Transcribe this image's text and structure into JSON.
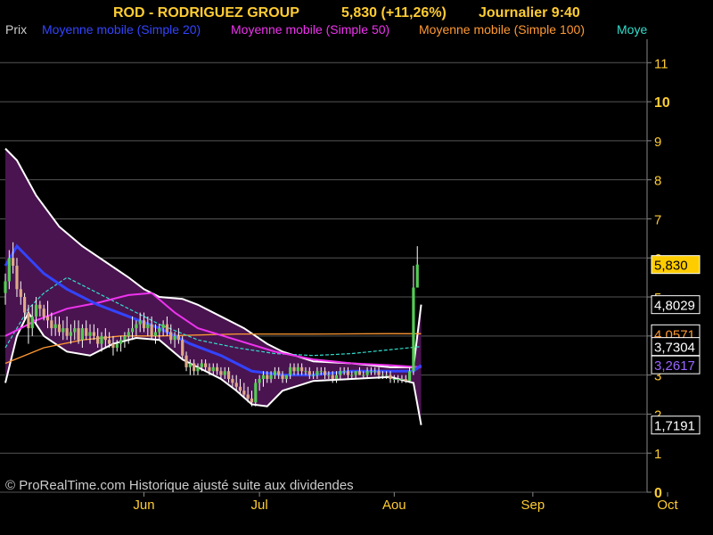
{
  "header": {
    "ticker": "ROD - RODRIGUEZ GROUP",
    "price_change": "5,830 (+11,26%)",
    "period_time": "Journalier  9:40"
  },
  "legend": {
    "items": [
      {
        "label": "Prix",
        "color": "#cccccc"
      },
      {
        "label": "Moyenne mobile (Simple 20)",
        "color": "#3344ff"
      },
      {
        "label": "Moyenne mobile (Simple 50)",
        "color": "#ee33ee"
      },
      {
        "label": "Moyenne mobile (Simple 100)",
        "color": "#ff9933"
      },
      {
        "label": "Moye",
        "color": "#33ddcc"
      }
    ]
  },
  "footer": {
    "copyright": "© ProRealTime.com Historique ajusté suite aux dividendes"
  },
  "colors": {
    "background": "#000000",
    "grid": "#555555",
    "axis_text": "#ffcc33",
    "band_fill": "#4a1450",
    "band_edge": "#ffffff",
    "candle_up": "#55cc55",
    "candle_down": "#ddaa88",
    "wick": "#ffffff"
  },
  "chart_data": {
    "type": "candlestick",
    "ylim": [
      0,
      11.6
    ],
    "y_ticks": [
      "0",
      "1",
      "2",
      "3",
      "4",
      "5",
      "6",
      "7",
      "8",
      "9",
      "10",
      "11"
    ],
    "x_ticks": [
      {
        "label": "Jun",
        "index": 36
      },
      {
        "label": "Jul",
        "index": 66
      },
      {
        "label": "Aou",
        "index": 101
      },
      {
        "label": "Sep",
        "index": 137
      },
      {
        "label": "Oct",
        "index": 172
      }
    ],
    "candles": [
      [
        5.1,
        5.6,
        4.8,
        5.4
      ],
      [
        5.4,
        6.2,
        5.2,
        6.0
      ],
      [
        6.0,
        6.4,
        5.6,
        5.8
      ],
      [
        5.8,
        6.0,
        5.0,
        5.2
      ],
      [
        5.2,
        5.4,
        4.8,
        5.0
      ],
      [
        5.0,
        5.1,
        4.4,
        4.6
      ],
      [
        4.6,
        4.8,
        3.8,
        4.2
      ],
      [
        4.2,
        4.8,
        4.0,
        4.5
      ],
      [
        4.5,
        5.0,
        4.3,
        4.8
      ],
      [
        4.8,
        4.9,
        4.5,
        4.7
      ],
      [
        4.7,
        4.8,
        4.4,
        4.5
      ],
      [
        4.5,
        4.9,
        4.2,
        4.4
      ],
      [
        4.4,
        4.6,
        4.0,
        4.2
      ],
      [
        4.2,
        4.5,
        4.0,
        4.3
      ],
      [
        4.3,
        4.5,
        4.0,
        4.1
      ],
      [
        4.1,
        4.4,
        3.9,
        4.2
      ],
      [
        4.2,
        4.5,
        3.9,
        4.0
      ],
      [
        4.0,
        4.3,
        3.8,
        4.1
      ],
      [
        4.1,
        4.4,
        3.9,
        4.2
      ],
      [
        4.2,
        4.4,
        3.8,
        3.9
      ],
      [
        3.9,
        4.3,
        3.7,
        4.2
      ],
      [
        4.2,
        4.4,
        3.9,
        4.0
      ],
      [
        4.0,
        4.3,
        3.8,
        4.1
      ],
      [
        4.1,
        4.3,
        3.9,
        4.0
      ],
      [
        4.0,
        4.2,
        3.7,
        3.8
      ],
      [
        3.8,
        4.1,
        3.6,
        4.0
      ],
      [
        4.0,
        4.2,
        3.7,
        3.9
      ],
      [
        3.9,
        4.1,
        3.7,
        3.8
      ],
      [
        3.8,
        4.0,
        3.5,
        3.7
      ],
      [
        3.7,
        3.9,
        3.6,
        3.8
      ],
      [
        3.8,
        4.0,
        3.6,
        3.9
      ],
      [
        3.9,
        4.1,
        3.7,
        4.0
      ],
      [
        4.0,
        4.2,
        3.8,
        4.1
      ],
      [
        4.1,
        4.5,
        3.9,
        4.2
      ],
      [
        4.2,
        4.4,
        4.0,
        4.3
      ],
      [
        4.3,
        4.6,
        4.1,
        4.4
      ],
      [
        4.4,
        4.6,
        4.1,
        4.2
      ],
      [
        4.2,
        4.5,
        4.0,
        4.3
      ],
      [
        4.3,
        4.5,
        3.9,
        4.0
      ],
      [
        4.0,
        4.3,
        3.8,
        4.1
      ],
      [
        4.1,
        4.3,
        3.9,
        4.2
      ],
      [
        4.2,
        4.4,
        4.0,
        4.3
      ],
      [
        4.3,
        4.5,
        4.0,
        4.1
      ],
      [
        4.1,
        4.3,
        3.8,
        3.9
      ],
      [
        3.9,
        4.1,
        3.7,
        4.0
      ],
      [
        4.0,
        4.2,
        3.8,
        3.9
      ],
      [
        3.9,
        4.0,
        3.4,
        3.5
      ],
      [
        3.5,
        3.6,
        3.1,
        3.2
      ],
      [
        3.2,
        3.4,
        3.0,
        3.3
      ],
      [
        3.3,
        3.4,
        3.0,
        3.1
      ],
      [
        3.1,
        3.3,
        3.0,
        3.2
      ],
      [
        3.2,
        3.4,
        3.1,
        3.3
      ],
      [
        3.3,
        3.4,
        3.1,
        3.2
      ],
      [
        3.2,
        3.3,
        3.0,
        3.1
      ],
      [
        3.1,
        3.3,
        3.0,
        3.2
      ],
      [
        3.2,
        3.3,
        3.0,
        3.1
      ],
      [
        3.1,
        3.2,
        2.9,
        3.0
      ],
      [
        3.0,
        3.2,
        2.9,
        3.1
      ],
      [
        3.1,
        3.2,
        2.8,
        2.9
      ],
      [
        2.9,
        3.0,
        2.7,
        2.8
      ],
      [
        2.8,
        3.0,
        2.6,
        2.7
      ],
      [
        2.7,
        2.9,
        2.5,
        2.6
      ],
      [
        2.6,
        2.8,
        2.4,
        2.5
      ],
      [
        2.5,
        2.7,
        2.3,
        2.4
      ],
      [
        2.4,
        2.6,
        2.2,
        2.3
      ],
      [
        2.3,
        2.9,
        2.2,
        2.8
      ],
      [
        2.8,
        3.0,
        2.6,
        2.9
      ],
      [
        2.9,
        3.1,
        2.7,
        3.0
      ],
      [
        3.0,
        3.1,
        2.8,
        2.9
      ],
      [
        2.9,
        3.1,
        2.8,
        3.0
      ],
      [
        3.0,
        3.2,
        2.9,
        3.1
      ],
      [
        3.1,
        3.2,
        2.9,
        3.0
      ],
      [
        3.0,
        3.1,
        2.8,
        2.9
      ],
      [
        2.9,
        3.0,
        2.8,
        3.0
      ],
      [
        3.0,
        3.3,
        2.9,
        3.2
      ],
      [
        3.2,
        3.3,
        3.0,
        3.1
      ],
      [
        3.1,
        3.3,
        3.0,
        3.2
      ],
      [
        3.2,
        3.3,
        3.0,
        3.1
      ],
      [
        3.1,
        3.2,
        3.0,
        3.1
      ],
      [
        3.1,
        3.2,
        2.9,
        3.0
      ],
      [
        3.0,
        3.1,
        2.9,
        3.0
      ],
      [
        3.0,
        3.2,
        2.9,
        3.1
      ],
      [
        3.1,
        3.2,
        3.0,
        3.1
      ],
      [
        3.1,
        3.2,
        2.9,
        3.0
      ],
      [
        3.0,
        3.1,
        2.9,
        3.0
      ],
      [
        3.0,
        3.1,
        2.8,
        2.9
      ],
      [
        2.9,
        3.1,
        2.8,
        3.0
      ],
      [
        3.0,
        3.2,
        2.9,
        3.1
      ],
      [
        3.1,
        3.2,
        3.0,
        3.1
      ],
      [
        3.1,
        3.2,
        2.9,
        3.0
      ],
      [
        3.0,
        3.1,
        2.9,
        3.0
      ],
      [
        3.0,
        3.1,
        2.9,
        3.1
      ],
      [
        3.1,
        3.2,
        3.0,
        3.0
      ],
      [
        3.0,
        3.1,
        2.9,
        3.0
      ],
      [
        3.0,
        3.2,
        2.9,
        3.1
      ],
      [
        3.1,
        3.2,
        3.0,
        3.1
      ],
      [
        3.1,
        3.2,
        3.0,
        3.1
      ],
      [
        3.1,
        3.2,
        2.9,
        3.0
      ],
      [
        3.0,
        3.1,
        2.9,
        3.0
      ],
      [
        3.0,
        3.1,
        2.9,
        3.0
      ],
      [
        3.0,
        3.1,
        2.8,
        2.9
      ],
      [
        2.9,
        3.0,
        2.8,
        2.9
      ],
      [
        2.9,
        3.0,
        2.8,
        2.9
      ],
      [
        2.9,
        3.0,
        2.8,
        2.9
      ],
      [
        2.9,
        3.0,
        2.8,
        2.85
      ],
      [
        2.85,
        3.2,
        2.8,
        3.1
      ],
      [
        3.1,
        5.8,
        3.0,
        5.24
      ],
      [
        5.24,
        6.3,
        5.6,
        5.83
      ]
    ],
    "sma20": [
      [
        0,
        5.8
      ],
      [
        3,
        6.3
      ],
      [
        6,
        6.0
      ],
      [
        10,
        5.6
      ],
      [
        16,
        5.2
      ],
      [
        24,
        4.8
      ],
      [
        32,
        4.5
      ],
      [
        40,
        4.2
      ],
      [
        48,
        3.8
      ],
      [
        56,
        3.5
      ],
      [
        64,
        3.1
      ],
      [
        72,
        3.0
      ],
      [
        80,
        3.0
      ],
      [
        90,
        3.1
      ],
      [
        100,
        3.1
      ],
      [
        106,
        3.1
      ],
      [
        108,
        3.25
      ]
    ],
    "sma50": [
      [
        0,
        4.0
      ],
      [
        8,
        4.4
      ],
      [
        16,
        4.7
      ],
      [
        24,
        4.85
      ],
      [
        32,
        5.05
      ],
      [
        38,
        5.1
      ],
      [
        44,
        4.6
      ],
      [
        50,
        4.2
      ],
      [
        60,
        3.9
      ],
      [
        70,
        3.6
      ],
      [
        80,
        3.4
      ],
      [
        90,
        3.3
      ],
      [
        100,
        3.25
      ],
      [
        108,
        3.2
      ]
    ],
    "sma100": [
      [
        0,
        3.3
      ],
      [
        10,
        3.7
      ],
      [
        20,
        3.9
      ],
      [
        30,
        4.0
      ],
      [
        40,
        4.0
      ],
      [
        60,
        4.05
      ],
      [
        80,
        4.05
      ],
      [
        100,
        4.06
      ],
      [
        108,
        4.0571
      ]
    ],
    "sma_other": [
      [
        0,
        3.7
      ],
      [
        6,
        4.7
      ],
      [
        10,
        5.1
      ],
      [
        16,
        5.5
      ],
      [
        24,
        5.1
      ],
      [
        32,
        4.7
      ],
      [
        40,
        4.3
      ],
      [
        50,
        3.9
      ],
      [
        60,
        3.7
      ],
      [
        70,
        3.55
      ],
      [
        80,
        3.5
      ],
      [
        90,
        3.55
      ],
      [
        100,
        3.65
      ],
      [
        108,
        3.7304
      ]
    ],
    "bollinger_upper": [
      [
        0,
        8.8
      ],
      [
        3,
        8.5
      ],
      [
        8,
        7.6
      ],
      [
        14,
        6.8
      ],
      [
        20,
        6.3
      ],
      [
        26,
        5.9
      ],
      [
        32,
        5.5
      ],
      [
        36,
        5.2
      ],
      [
        40,
        5.0
      ],
      [
        46,
        4.95
      ],
      [
        50,
        4.8
      ],
      [
        56,
        4.5
      ],
      [
        62,
        4.2
      ],
      [
        68,
        3.8
      ],
      [
        72,
        3.6
      ],
      [
        80,
        3.35
      ],
      [
        90,
        3.3
      ],
      [
        100,
        3.2
      ],
      [
        106,
        3.2
      ],
      [
        108,
        4.8029
      ]
    ],
    "bollinger_lower": [
      [
        0,
        2.8
      ],
      [
        3,
        4.0
      ],
      [
        6,
        4.6
      ],
      [
        10,
        4.0
      ],
      [
        16,
        3.6
      ],
      [
        22,
        3.5
      ],
      [
        28,
        3.8
      ],
      [
        34,
        3.95
      ],
      [
        40,
        3.9
      ],
      [
        46,
        3.4
      ],
      [
        52,
        3.1
      ],
      [
        56,
        2.9
      ],
      [
        60,
        2.6
      ],
      [
        64,
        2.25
      ],
      [
        68,
        2.2
      ],
      [
        72,
        2.6
      ],
      [
        80,
        2.85
      ],
      [
        90,
        2.9
      ],
      [
        100,
        2.95
      ],
      [
        106,
        2.8
      ],
      [
        108,
        1.7191
      ]
    ],
    "right_labels": [
      {
        "text": "5,830",
        "value": 5.83,
        "bg": "#ffcc00",
        "fg": "#000000"
      },
      {
        "text": "4,8029",
        "value": 4.8029,
        "bg": "#000000",
        "fg": "#ffffff"
      },
      {
        "text": "4,0571",
        "value": 4.0571,
        "bg": "#000000",
        "fg": "#ff9933"
      },
      {
        "text": "3,7304",
        "value": 3.7304,
        "bg": "#000000",
        "fg": "#ffffff"
      },
      {
        "text": "3,2617",
        "value": 3.2617,
        "bg": "#000000",
        "fg": "#9966ff"
      },
      {
        "text": "1,7191",
        "value": 1.7191,
        "bg": "#000000",
        "fg": "#ffffff"
      }
    ]
  }
}
